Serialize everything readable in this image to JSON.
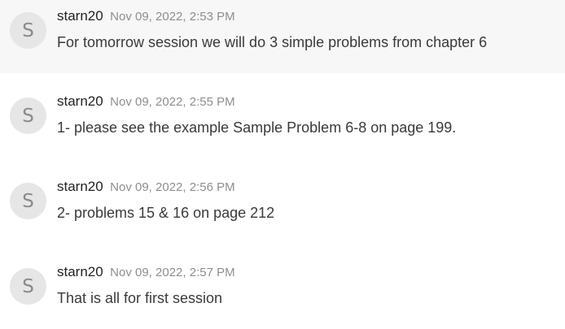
{
  "messages": [
    {
      "avatar_initial": "S",
      "author": "starn20",
      "timestamp": "Nov 09, 2022, 2:53 PM",
      "text": "For tomorrow session we will do 3 simple problems from chapter 6"
    },
    {
      "avatar_initial": "S",
      "author": "starn20",
      "timestamp": "Nov 09, 2022, 2:55 PM",
      "text": "1- please see the example Sample Problem 6-8 on page 199."
    },
    {
      "avatar_initial": "S",
      "author": "starn20",
      "timestamp": "Nov 09, 2022, 2:56 PM",
      "text": "2- problems 15 & 16 on page 212"
    },
    {
      "avatar_initial": "S",
      "author": "starn20",
      "timestamp": "Nov 09, 2022, 2:57 PM",
      "text": "That is all for first session"
    }
  ],
  "colors": {
    "highlight_background": "#f7f7f7",
    "avatar_background": "#e6e6e6",
    "avatar_text": "#8a8a8a",
    "timestamp_text": "#8e8e8e"
  }
}
